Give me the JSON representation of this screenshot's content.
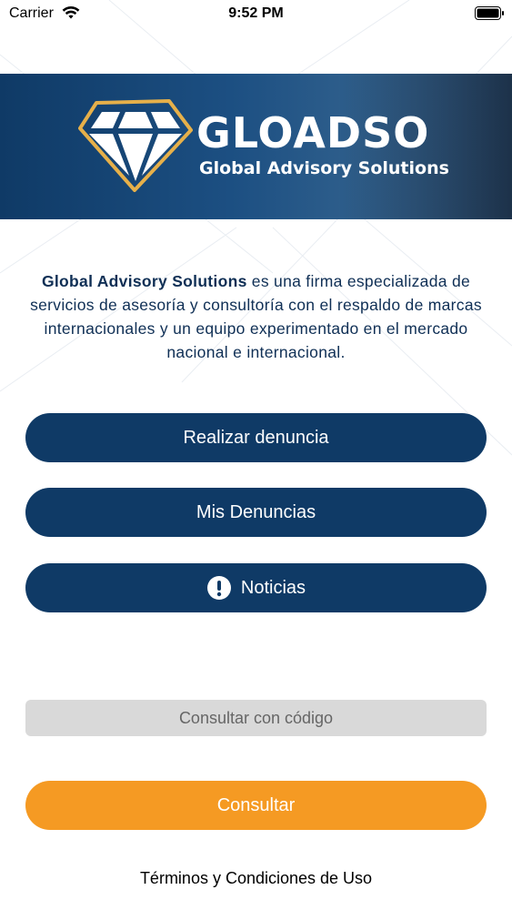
{
  "status_bar": {
    "carrier": "Carrier",
    "time": "9:52 PM",
    "wifi_icon": "wifi-icon",
    "battery_icon": "battery-icon"
  },
  "banner": {
    "logo_icon": "diamond-icon",
    "brand_name": "GLOADSO",
    "brand_subtitle": "Global Advisory Solutions",
    "colors": {
      "background": "#0f3a66",
      "logo_gold": "#e6b04a",
      "text": "#ffffff"
    }
  },
  "description": {
    "strong": "Global Advisory Solutions",
    "rest": " es una firma especializada de servicios de asesoría y consultoría con el respaldo de marcas internacionales y un equipo experimentado en el mercado nacional e internacional."
  },
  "buttons": {
    "realizar_denuncia": "Realizar denuncia",
    "mis_denuncias": "Mis Denuncias",
    "noticias": "Noticias",
    "noticias_icon": "alert-circle-icon",
    "consultar": "Consultar"
  },
  "code_field": {
    "placeholder": "Consultar con código",
    "value": ""
  },
  "footer": {
    "terms": "Términos y Condiciones de Uso"
  },
  "colors": {
    "primary": "#0f3a66",
    "accent": "#f59a23",
    "input_bg": "#d9d9d9",
    "text_dark": "#0f2f55"
  }
}
